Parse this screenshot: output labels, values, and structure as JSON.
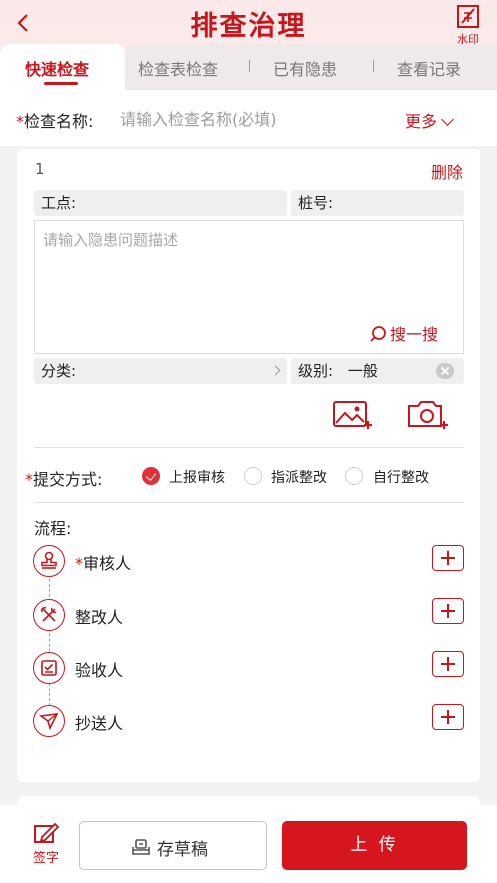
{
  "header": {
    "title": "排查治理",
    "back_icon": "chevron-left-icon",
    "watermark_label": "水印"
  },
  "tabs": [
    {
      "label": "快速检查",
      "active": true
    },
    {
      "label": "检查表检查",
      "active": false
    },
    {
      "label": "已有隐患",
      "active": false
    },
    {
      "label": "查看记录",
      "active": false
    }
  ],
  "form": {
    "name_label": "检查名称:",
    "name_required_mark": "*",
    "name_placeholder": "请输入检查名称(必填)",
    "more_label": "更多"
  },
  "hazard": {
    "index": "1",
    "delete_label": "删除",
    "work_point_label": "工点:",
    "pile_no_label": "桩号:",
    "description_placeholder": "请输入隐患问题描述",
    "search_label": "搜一搜",
    "category_label": "分类:",
    "level_label": "级别:",
    "level_value": "一般"
  },
  "submit": {
    "required_mark": "*",
    "label": "提交方式:",
    "options": [
      {
        "label": "上报审核",
        "checked": true
      },
      {
        "label": "指派整改",
        "checked": false
      },
      {
        "label": "自行整改",
        "checked": false
      }
    ]
  },
  "flow": {
    "label": "流程:",
    "steps": [
      {
        "required_mark": "*",
        "name": "审核人",
        "icon": "stamp-icon"
      },
      {
        "required_mark": "",
        "name": "整改人",
        "icon": "tools-icon"
      },
      {
        "required_mark": "",
        "name": "验收人",
        "icon": "checklist-icon"
      },
      {
        "required_mark": "",
        "name": "抄送人",
        "icon": "send-icon"
      }
    ]
  },
  "bottom": {
    "sign_label": "签字",
    "draft_label": "存草稿",
    "upload_label": "上 传"
  },
  "colors": {
    "accent": "#c8161d",
    "upload_button": "#d6161e",
    "background": "#f3eeee"
  }
}
